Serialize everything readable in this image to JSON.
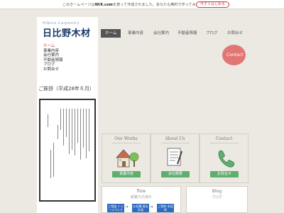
{
  "banner": {
    "prefix": "このホームページは",
    "brand": "WiX.com",
    "suffix": "を使って作成されました。あなたも無料で作ってみませんか？",
    "button": "今すぐはじめる"
  },
  "brand": {
    "name_en": "Hibino Carpentry",
    "name_jp": "日比野木材"
  },
  "sidebar": {
    "items": [
      {
        "label": "ホーム",
        "active": true
      },
      {
        "label": "事業内容"
      },
      {
        "label": "会社案内"
      },
      {
        "label": "不動産情報"
      },
      {
        "label": "ブログ"
      },
      {
        "label": "お問合せ"
      }
    ]
  },
  "greeting": {
    "title": "ご挨拶（平成28年６月）"
  },
  "nav": {
    "items": [
      {
        "label": "ホーム",
        "active": true
      },
      {
        "label": "事業内容"
      },
      {
        "label": "会社案内"
      },
      {
        "label": "不動産情報"
      },
      {
        "label": "ブログ"
      },
      {
        "label": "お問合せ"
      }
    ]
  },
  "contact_bubble": {
    "label": "Contact"
  },
  "cards": [
    {
      "title": "Our Works",
      "button": "事業内容",
      "icon": "house-tree-icon"
    },
    {
      "title": "About Us",
      "button": "会社概要",
      "icon": "document-pen-icon"
    },
    {
      "title": "Contact",
      "button": "お問合せ",
      "icon": "phone-icon"
    }
  ],
  "flow": {
    "title": "flow",
    "subtitle": "新築りの流れ",
    "steps": [
      "ご相談 イメージづくり",
      "お見積 資金計画",
      "ご契約 本契約"
    ]
  },
  "blog": {
    "title": "Blog",
    "subtitle": "ブログ"
  },
  "colors": {
    "accent": "#c83c3c",
    "button_green": "#5fae6e",
    "flow_blue": "#2f6ac0",
    "contact_pink": "#e07775"
  }
}
